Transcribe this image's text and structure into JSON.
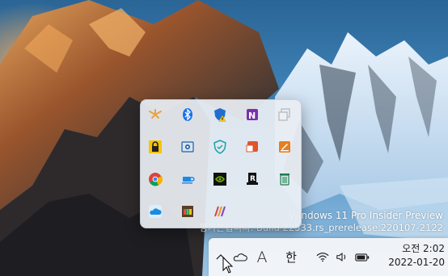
{
  "watermark": {
    "line1": "Windows 11 Pro Insider Preview",
    "line2": "평가본입니다. Build 22533.rs_prerelease.220107-2122"
  },
  "tray_flyout": {
    "icons": [
      {
        "name": "app-orange-icon",
        "color": "#e8a33b"
      },
      {
        "name": "bluetooth-icon",
        "color": "#1a73e8"
      },
      {
        "name": "security-shield-warning-icon",
        "color": "#1f6fd1"
      },
      {
        "name": "onenote-icon",
        "color": "#7b2fb0"
      },
      {
        "name": "copy-window-icon",
        "color": "#c9cdd2"
      },
      {
        "name": "lock-icon",
        "color": "#f7c400"
      },
      {
        "name": "camera-app-icon",
        "color": "#1d5fa8"
      },
      {
        "name": "shield-check-icon",
        "color": "#1aa4a4"
      },
      {
        "name": "presentation-icon",
        "color": "#e0552b"
      },
      {
        "name": "edit-app-icon",
        "color": "#e67e22"
      },
      {
        "name": "chrome-icon",
        "color": "#db4437"
      },
      {
        "name": "coffee-cup-icon",
        "color": "#1e88e5"
      },
      {
        "name": "nvidia-icon",
        "color": "#76b900"
      },
      {
        "name": "r-app-icon",
        "color": "#111111"
      },
      {
        "name": "recycle-bin-icon",
        "color": "#1d7b52"
      },
      {
        "name": "onedrive-cloud-icon",
        "color": "#1a8be0"
      },
      {
        "name": "colorful-app-icon",
        "color": "#e74c3c"
      },
      {
        "name": "striped-app-icon",
        "color": "#d64545"
      }
    ]
  },
  "taskbar": {
    "ime_mode": "A",
    "ime_lang": "한",
    "time": "오전 2:02",
    "date": "2022-01-20"
  }
}
